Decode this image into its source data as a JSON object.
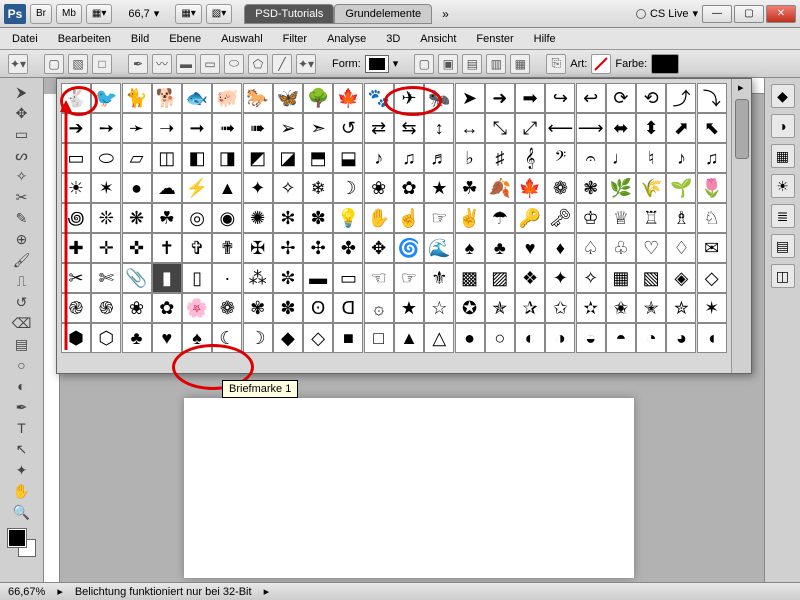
{
  "title": {
    "app": "Ps",
    "br": "Br",
    "mb": "Mb",
    "zoom": "66,7",
    "tab_active": "PSD-Tutorials",
    "tab_inactive": "Grundelemente",
    "cslive": "CS Live"
  },
  "menu": [
    "Datei",
    "Bearbeiten",
    "Bild",
    "Ebene",
    "Auswahl",
    "Filter",
    "Analyse",
    "3D",
    "Ansicht",
    "Fenster",
    "Hilfe"
  ],
  "optbar": {
    "form_label": "Form:",
    "art_label": "Art:",
    "farbe_label": "Farbe:"
  },
  "tooltip": "Briefmarke 1",
  "status": {
    "zoom": "66,67%",
    "info": "Belichtung funktioniert nur bei 32-Bit"
  },
  "shape_hint": "Custom shapes grid",
  "chart_data": {
    "type": "table",
    "title": "Photoshop Custom Shape Picker",
    "note": "Grid of ~200 custom vector shapes (animals, arrows, frames, symbols, ornaments etc.). Highlighted selected shape: 'Briefmarke 1' (stamp). Tooltip shows 'Briefmarke 1'. Red annotations circle: paths-mode button in options bar, the custom-shape dropdown in options bar, and the selected stamp shape in the grid. Red arrow points from shape panel up to options bar paths button.",
    "rows": 9,
    "cols": 22,
    "selected_shape": "Briefmarke 1"
  }
}
